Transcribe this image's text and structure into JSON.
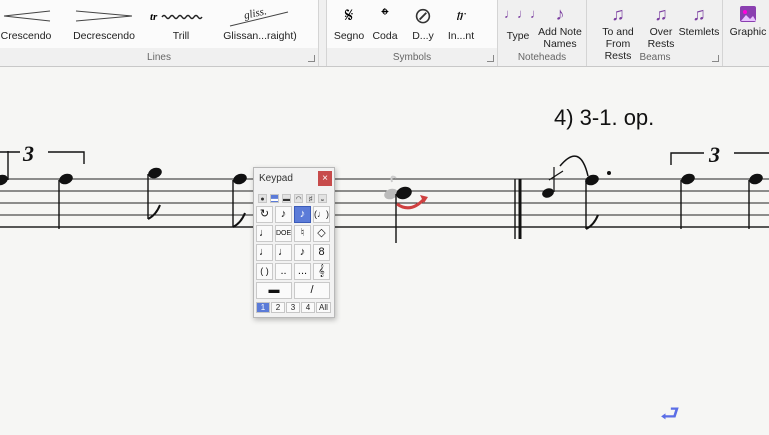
{
  "ribbon": {
    "lines_group": {
      "label": "Lines",
      "buttons": [
        {
          "label": "Crescendo",
          "icon": "crescendo-hairpin-icon"
        },
        {
          "label": "Decrescendo",
          "icon": "decrescendo-hairpin-icon"
        },
        {
          "label": "Trill",
          "icon": "trill-line-icon"
        },
        {
          "label": "Glissan...raight)",
          "icon": "glissando-straight-icon",
          "icon_text": "gliss."
        }
      ]
    },
    "symbols_group": {
      "label": "Symbols",
      "buttons": [
        {
          "label": "Segno",
          "icon": "segno-icon",
          "glyph": "𝄋"
        },
        {
          "label": "Coda",
          "icon": "coda-icon",
          "glyph": "𝄌"
        },
        {
          "label": "D...y",
          "icon": "d-y-icon",
          "glyph": "⊘"
        },
        {
          "label": "In...nt",
          "icon": "in-nt-icon",
          "glyph": "𝆖"
        }
      ]
    },
    "noteheads_group": {
      "label": "Noteheads",
      "buttons": [
        {
          "label": "Type",
          "icon": "notehead-type-icon",
          "glyph": "♩♩♩"
        },
        {
          "label": "Add Note Names",
          "icon": "add-note-names-icon",
          "glyph": "♪"
        }
      ]
    },
    "beams_group": {
      "label": "Beams",
      "buttons": [
        {
          "label": "To and From Rests",
          "icon": "beam-rests-icon",
          "glyph": "♫"
        },
        {
          "label": "Over Rests",
          "icon": "beam-over-rests-icon",
          "glyph": "♫"
        },
        {
          "label": "Stemlets",
          "icon": "stemlets-icon",
          "glyph": "♫"
        }
      ]
    },
    "graphics_group": {
      "buttons": [
        {
          "label": "Graphic",
          "icon": "graphic-icon"
        }
      ]
    }
  },
  "score": {
    "rehearsal_text": "4) 3-1. op.",
    "tuplet_numbers": [
      "3",
      "3"
    ]
  },
  "keypad": {
    "title": "Keypad",
    "close_glyph": "×",
    "tabs": [
      "●",
      "▬",
      "▬",
      "◠",
      "♯",
      "𝄪"
    ],
    "keys": [
      "↻",
      "♪",
      "♪",
      "(♩)",
      "♩",
      "DOE",
      "♮",
      "◇",
      "♩",
      "♩",
      "♪",
      "8",
      "( )",
      "..",
      "...",
      "𝄞"
    ],
    "wide_keys": [
      "▬",
      "/"
    ],
    "layers": [
      "1",
      "2",
      "3",
      "4",
      "All"
    ]
  },
  "colors": {
    "accent": "#5b7bd8",
    "selection": "#d04040",
    "ribbon_bg": "#f0f0f0"
  }
}
